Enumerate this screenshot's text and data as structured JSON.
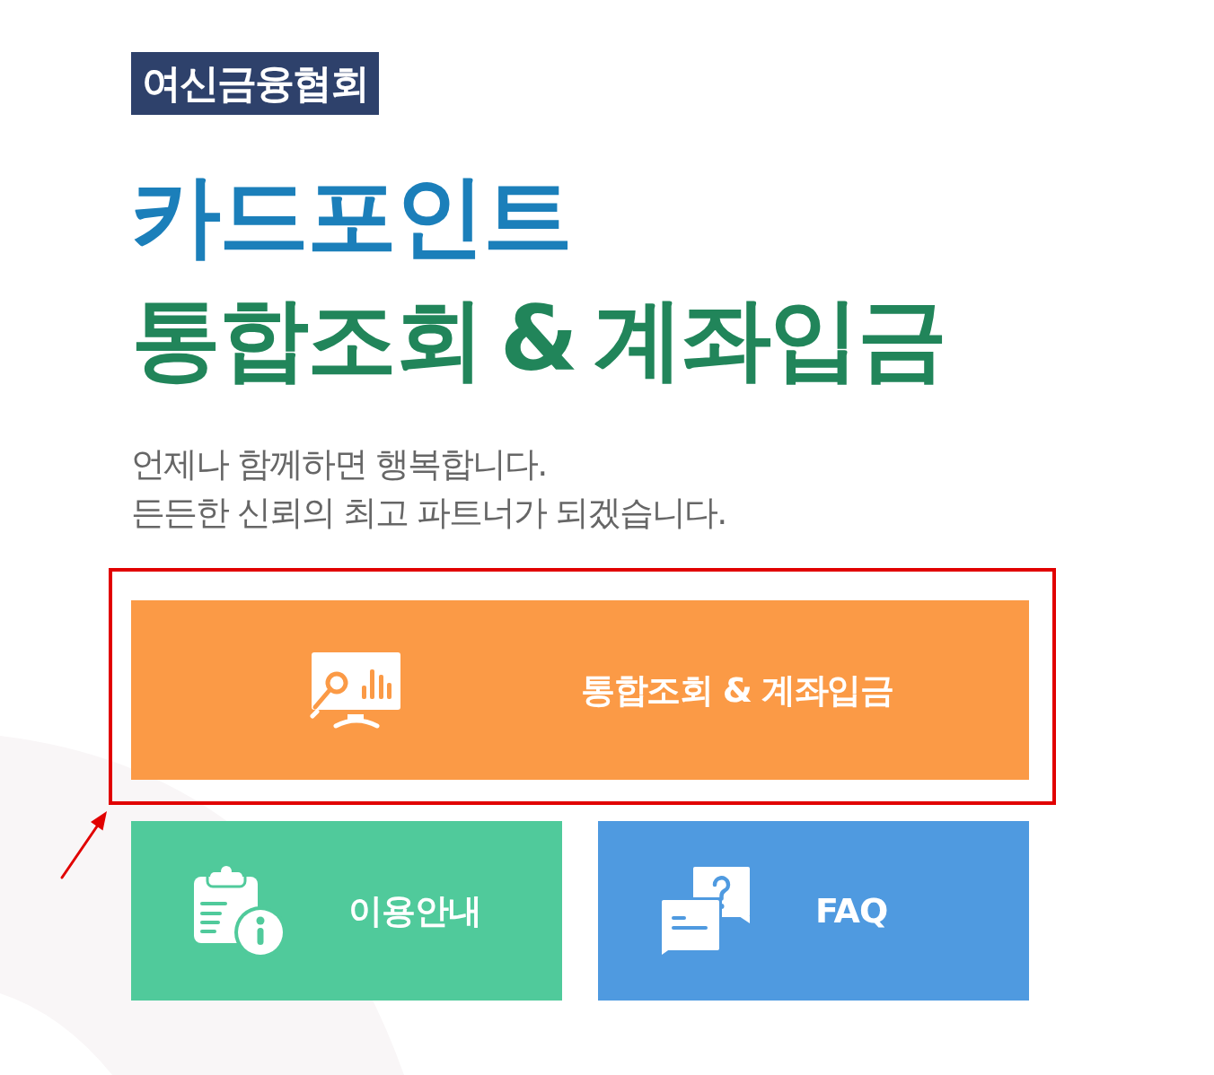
{
  "organization_badge": "여신금융협회",
  "title": {
    "line_1": "카드포인트",
    "line_2": "통합조회 & 계좌입금"
  },
  "tagline": [
    "언제나 함께하면 행복합니다.",
    "든든한 신뢰의 최고 파트너가 되겠습니다."
  ],
  "main_button": {
    "label": "통합조회 & 계좌입금",
    "highlighted": true
  },
  "tiles": [
    {
      "label": "이용안내",
      "kind": "guide",
      "color": "#50ca9b"
    },
    {
      "label": "FAQ",
      "kind": "faq",
      "color": "#4f9ae0"
    }
  ]
}
